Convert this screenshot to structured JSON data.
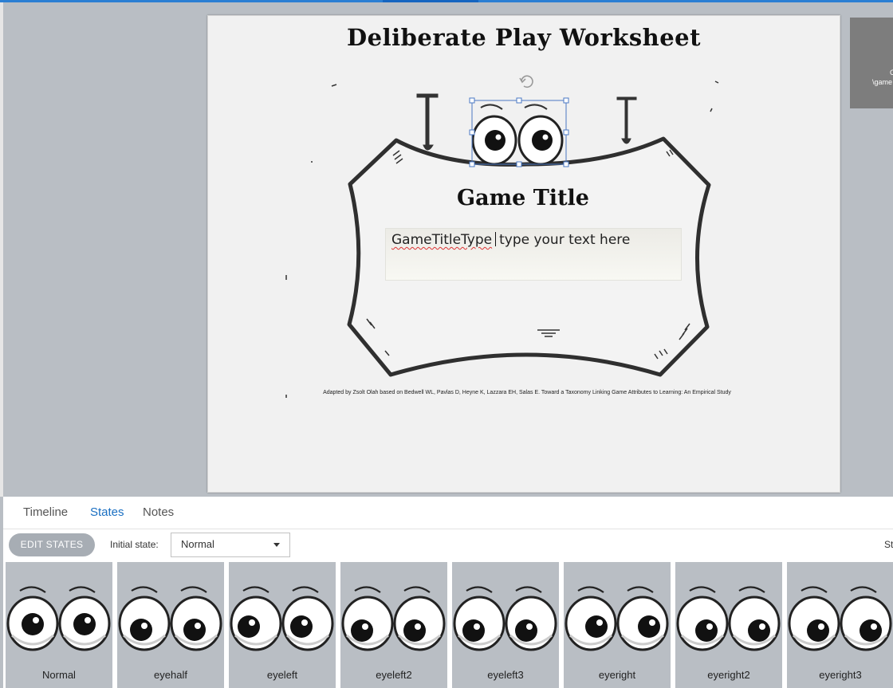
{
  "slide": {
    "title": "Deliberate Play Worksheet",
    "game_title": "Game Title",
    "text_box": {
      "variable": "GameTitleType",
      "placeholder": "type your text here"
    },
    "citation": "Adapted by Zsolt Olah based on Bedwell WL, Pavlas D, Heyne K, Lazzara EH, Salas E.  Toward a Taxonomy Linking Game Attributes to Learning: An Empirical Study"
  },
  "side_thumbnail": {
    "line1": "C",
    "line2": "\\game"
  },
  "tabs": [
    {
      "label": "Timeline",
      "active": false
    },
    {
      "label": "States",
      "active": true
    },
    {
      "label": "Notes",
      "active": false
    }
  ],
  "toolbar": {
    "edit_states_label": "EDIT STATES",
    "initial_state_label": "Initial state:",
    "initial_state_value": "Normal",
    "right_cut_text": "St"
  },
  "states": [
    {
      "label": "Normal",
      "pupils": "center"
    },
    {
      "label": "eyehalf",
      "pupils": "down"
    },
    {
      "label": "eyeleft",
      "pupils": "left"
    },
    {
      "label": "eyeleft2",
      "pupils": "down-left"
    },
    {
      "label": "eyeleft3",
      "pupils": "down-left"
    },
    {
      "label": "eyeright",
      "pupils": "right"
    },
    {
      "label": "eyeright2",
      "pupils": "down-right"
    },
    {
      "label": "eyeright3",
      "pupils": "down-right"
    }
  ],
  "colors": {
    "accent": "#1a6fc2",
    "canvas_bg": "#b9bec4",
    "slide_bg": "#f1f1f1",
    "selection": "#4a78c4"
  },
  "icons": {
    "rotate_handle": "rotate-icon",
    "dropdown": "chevron-down-icon"
  }
}
